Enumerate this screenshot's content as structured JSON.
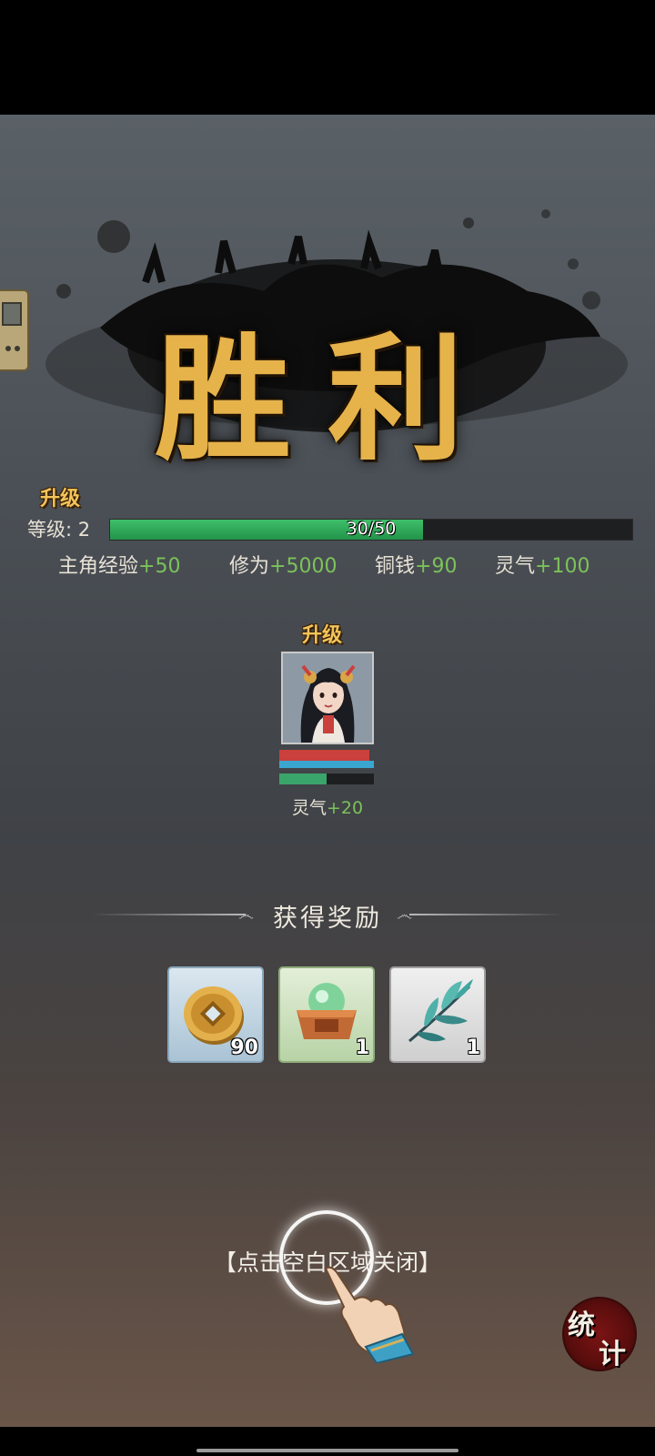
{
  "victory": {
    "title": "胜利"
  },
  "level_up_tag": "升级",
  "level": {
    "label": "等级:",
    "value": "2",
    "xp_text": "30/50",
    "xp_current": 30,
    "xp_max": 50
  },
  "stats": [
    {
      "name": "主角经验",
      "gain": "+50"
    },
    {
      "name": "修为",
      "gain": "+5000"
    },
    {
      "name": "铜钱",
      "gain": "+90"
    },
    {
      "name": "灵气",
      "gain": "+100"
    }
  ],
  "hero": {
    "level_up_tag": "升级",
    "reward_name": "灵气",
    "reward_gain": "+20",
    "hp_fraction": 0.95,
    "mp_fraction": 1.0,
    "exp_fraction": 0.5
  },
  "rewards": {
    "title": "获得奖励",
    "items": [
      {
        "icon": "copper-coin-icon",
        "count": "90"
      },
      {
        "icon": "spirit-orb-box-icon",
        "count": "1"
      },
      {
        "icon": "herb-leaf-icon",
        "count": "1"
      }
    ]
  },
  "close_hint": "【点击空白区域关闭】",
  "stats_button": {
    "char1": "统",
    "char2": "计"
  },
  "colors": {
    "gold": "#e6b24a",
    "gain_green": "#7cc25a",
    "xp_green": "#2fae5a",
    "hp_red": "#c9403c",
    "mp_blue": "#3aa6cf"
  }
}
